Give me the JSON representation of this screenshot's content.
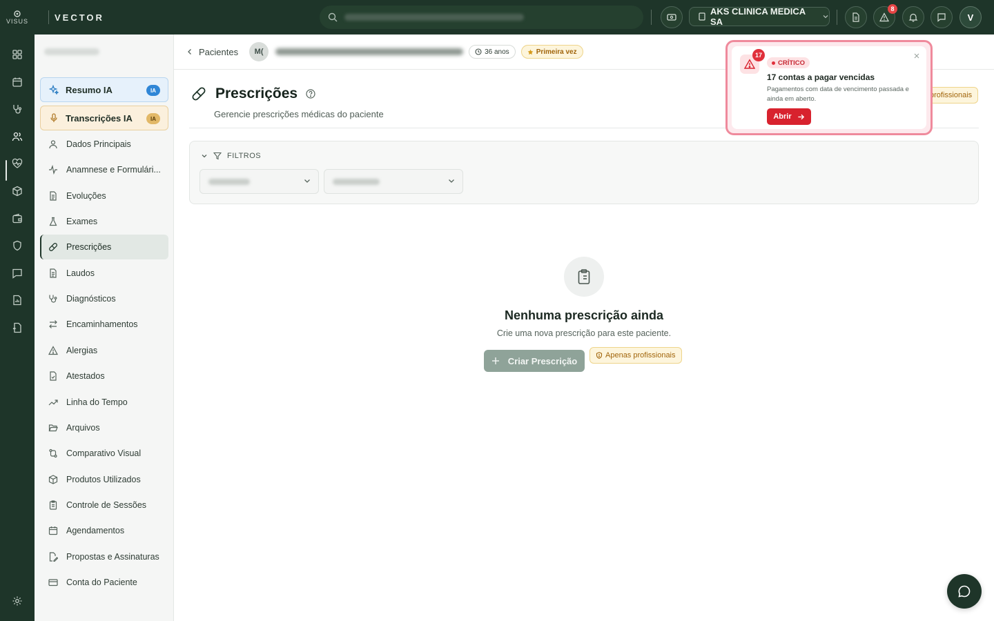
{
  "app": {
    "logo_word": "VISUS",
    "brand": "VECTOR"
  },
  "header": {
    "clinic": "AKS CLINICA MEDICA SA",
    "alerts_badge": "8",
    "user_initial": "V"
  },
  "sidebar": {
    "ai_items": [
      {
        "label": "Resumo IA",
        "tag": "IA"
      },
      {
        "label": "Transcrições IA",
        "tag": "IA"
      }
    ],
    "items": [
      {
        "label": "Dados Principais"
      },
      {
        "label": "Anamnese e Formulári..."
      },
      {
        "label": "Evoluções"
      },
      {
        "label": "Exames"
      },
      {
        "label": "Prescrições"
      },
      {
        "label": "Laudos"
      },
      {
        "label": "Diagnósticos"
      },
      {
        "label": "Encaminhamentos"
      },
      {
        "label": "Alergias"
      },
      {
        "label": "Atestados"
      },
      {
        "label": "Linha do Tempo"
      },
      {
        "label": "Arquivos"
      },
      {
        "label": "Comparativo Visual"
      },
      {
        "label": "Produtos Utilizados"
      },
      {
        "label": "Controle de Sessões"
      },
      {
        "label": "Agendamentos"
      },
      {
        "label": "Propostas e Assinaturas"
      },
      {
        "label": "Conta do Paciente"
      }
    ]
  },
  "breadcrumb": {
    "back_label": "Pacientes",
    "avatar_initials": "M(",
    "age": "36 anos",
    "first_visit": "Primeira vez"
  },
  "page": {
    "title": "Prescrições",
    "subtitle": "Gerencie prescrições médicas do paciente",
    "pro_only_partial": "profissionais"
  },
  "filters": {
    "label": "FILTROS"
  },
  "empty": {
    "title": "Nenhuma prescrição ainda",
    "subtitle": "Crie uma nova prescrição para este paciente.",
    "create_label": "Criar Prescrição",
    "pro_only": "Apenas profissionais"
  },
  "toast": {
    "count_badge": "17",
    "severity": "CRÍTICO",
    "title": "17 contas a pagar vencidas",
    "message": "Pagamentos com data de vencimento passada e ainda em aberto.",
    "open_label": "Abrir"
  },
  "colors": {
    "brand_dark": "#1e3529",
    "critical": "#d8222e",
    "warning_bg": "#fdf5dc"
  }
}
